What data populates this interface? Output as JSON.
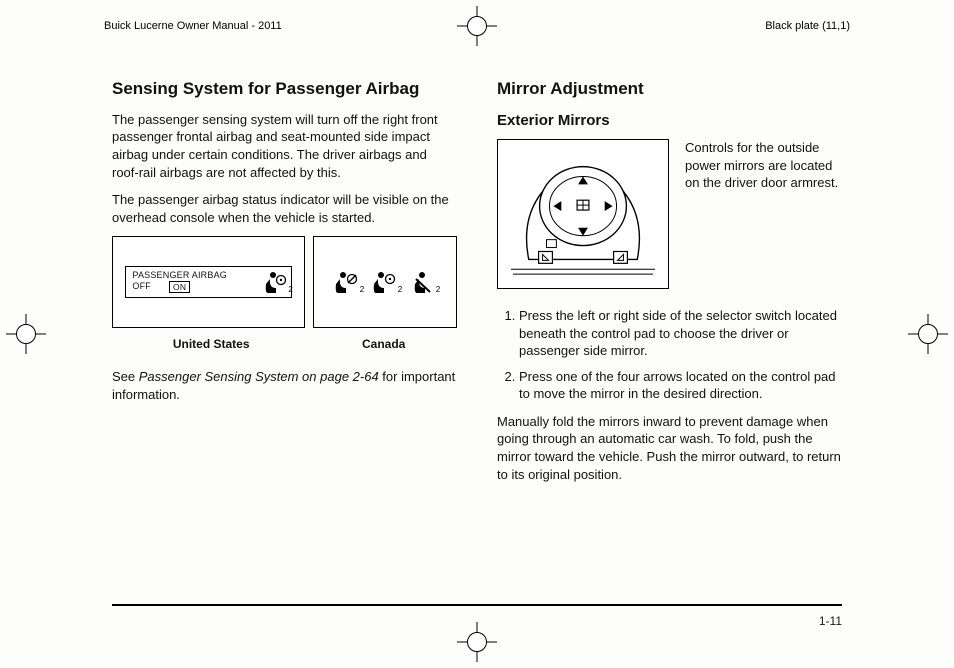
{
  "header": {
    "left": "Buick Lucerne Owner Manual - 2011",
    "right": "Black plate (11,1)"
  },
  "left_column": {
    "heading": "Sensing System for Passenger Airbag",
    "para1": "The passenger sensing system will turn off the right front passenger frontal airbag and seat-mounted side impact airbag under certain conditions. The driver airbags and roof-rail airbags are not affected by this.",
    "para2": "The passenger airbag status indicator will be visible on the overhead console when the vehicle is started.",
    "us_label_line1": "PASSENGER AIRBAG",
    "us_label_line2a": "OFF",
    "us_label_on": "ON",
    "caption_us": "United States",
    "caption_ca": "Canada",
    "see_prefix": "See ",
    "see_ref": "Passenger Sensing System on page 2-64",
    "see_suffix": " for important information."
  },
  "right_column": {
    "heading": "Mirror Adjustment",
    "subheading": "Exterior Mirrors",
    "mirror_desc": "Controls for the outside power mirrors are located on the driver door armrest.",
    "step1": "Press the left or right side of the selector switch located beneath the control pad to choose the driver or passenger side mirror.",
    "step2": "Press one of the four arrows located on the control pad to move the mirror in the desired direction.",
    "tail": "Manually fold the mirrors inward to prevent damage when going through an automatic car wash. To fold, push the mirror toward the vehicle. Push the mirror outward, to return to its original position."
  },
  "footer": {
    "page_number": "1-11"
  }
}
